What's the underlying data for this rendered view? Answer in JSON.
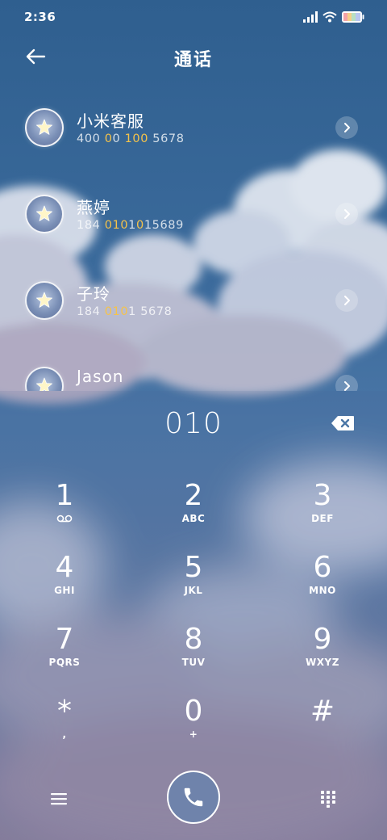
{
  "status_bar": {
    "time": "2:36"
  },
  "header": {
    "title": "通话"
  },
  "contacts": [
    {
      "name": "小米客服",
      "number_pre": "400 ",
      "number_hl": "0",
      "number_mid": "0 ",
      "number_hl2": "100",
      "number_post": " 5678"
    },
    {
      "name": "燕婷",
      "number_pre": "184 ",
      "number_hl": "010",
      "number_mid": "1",
      "number_hl2": "0",
      "number_post": "15689"
    },
    {
      "name": "子玲",
      "number_pre": "184 ",
      "number_hl": "010",
      "number_mid": "1",
      "number_hl2": "",
      "number_post": " 5678"
    },
    {
      "name": "Jason",
      "number_pre": "",
      "number_hl": "",
      "number_mid": "",
      "number_hl2": "",
      "number_post": ""
    }
  ],
  "dialer": {
    "entered_number": "010",
    "keys": [
      {
        "digit": "1",
        "sub": ""
      },
      {
        "digit": "2",
        "sub": "ABC"
      },
      {
        "digit": "3",
        "sub": "DEF"
      },
      {
        "digit": "4",
        "sub": "GHI"
      },
      {
        "digit": "5",
        "sub": "JKL"
      },
      {
        "digit": "6",
        "sub": "MNO"
      },
      {
        "digit": "7",
        "sub": "PQRS"
      },
      {
        "digit": "8",
        "sub": "TUV"
      },
      {
        "digit": "9",
        "sub": "WXYZ"
      },
      {
        "digit": "*",
        "sub": ","
      },
      {
        "digit": "0",
        "sub": "+"
      },
      {
        "digit": "#",
        "sub": ""
      }
    ]
  },
  "icons": {
    "back": "arrow-left-icon",
    "contact_avatar": "star-icon",
    "chevron": "chevron-right-icon",
    "backspace": "backspace-icon",
    "voicemail": "voicemail-icon",
    "menu": "menu-icon",
    "call": "phone-icon",
    "keypad": "keypad-icon"
  },
  "colors": {
    "highlight": "#f6c34a",
    "call_button": "#6f83ab"
  }
}
